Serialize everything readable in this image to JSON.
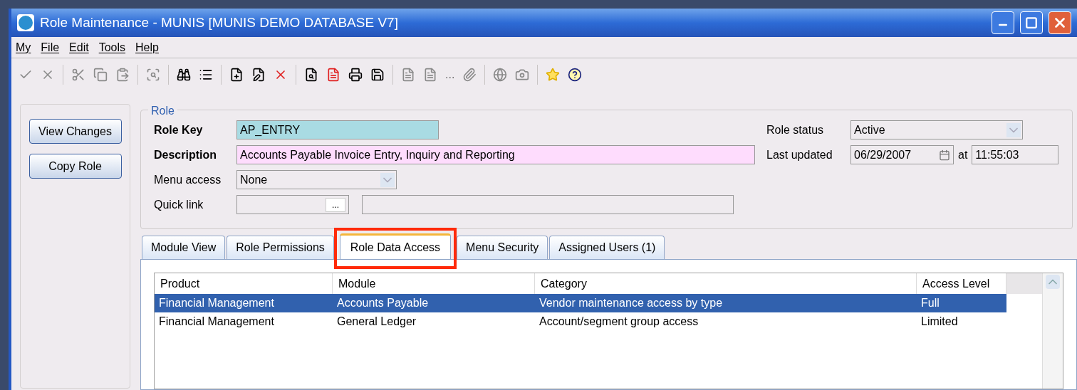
{
  "window": {
    "title": "Role Maintenance - MUNIS [MUNIS DEMO DATABASE V7]"
  },
  "menu": [
    "My",
    "File",
    "Edit",
    "Tools",
    "Help"
  ],
  "toolbar": {
    "more_label": "..."
  },
  "side_buttons": [
    "View Changes",
    "Copy Role"
  ],
  "role": {
    "group_title": "Role",
    "role_key": {
      "label": "Role Key",
      "value": "AP_ENTRY"
    },
    "description": {
      "label": "Description",
      "value": "Accounts Payable Invoice Entry, Inquiry and Reporting"
    },
    "menu_access": {
      "label": "Menu access",
      "value": "None"
    },
    "quick_link": {
      "label": "Quick link",
      "button": "..."
    },
    "role_status": {
      "label": "Role status",
      "value": "Active"
    },
    "last_updated": {
      "label": "Last updated",
      "date": "06/29/2007",
      "at": "at",
      "time": "11:55:03"
    }
  },
  "tabs": [
    {
      "label": "Module View",
      "selected": false
    },
    {
      "label": "Role Permissions",
      "selected": false
    },
    {
      "label": "Role Data Access",
      "selected": true
    },
    {
      "label": "Menu Security",
      "selected": false
    },
    {
      "label": "Assigned Users (1)",
      "selected": false
    }
  ],
  "table": {
    "columns": [
      "Product",
      "Module",
      "Category",
      "Access Level"
    ],
    "rows": [
      {
        "cells": [
          "Financial Management",
          "Accounts Payable",
          "Vendor maintenance access by type",
          "Full"
        ],
        "selected": true
      },
      {
        "cells": [
          "Financial Management",
          "General Ledger",
          "Account/segment group access",
          "Limited"
        ],
        "selected": false
      }
    ]
  }
}
